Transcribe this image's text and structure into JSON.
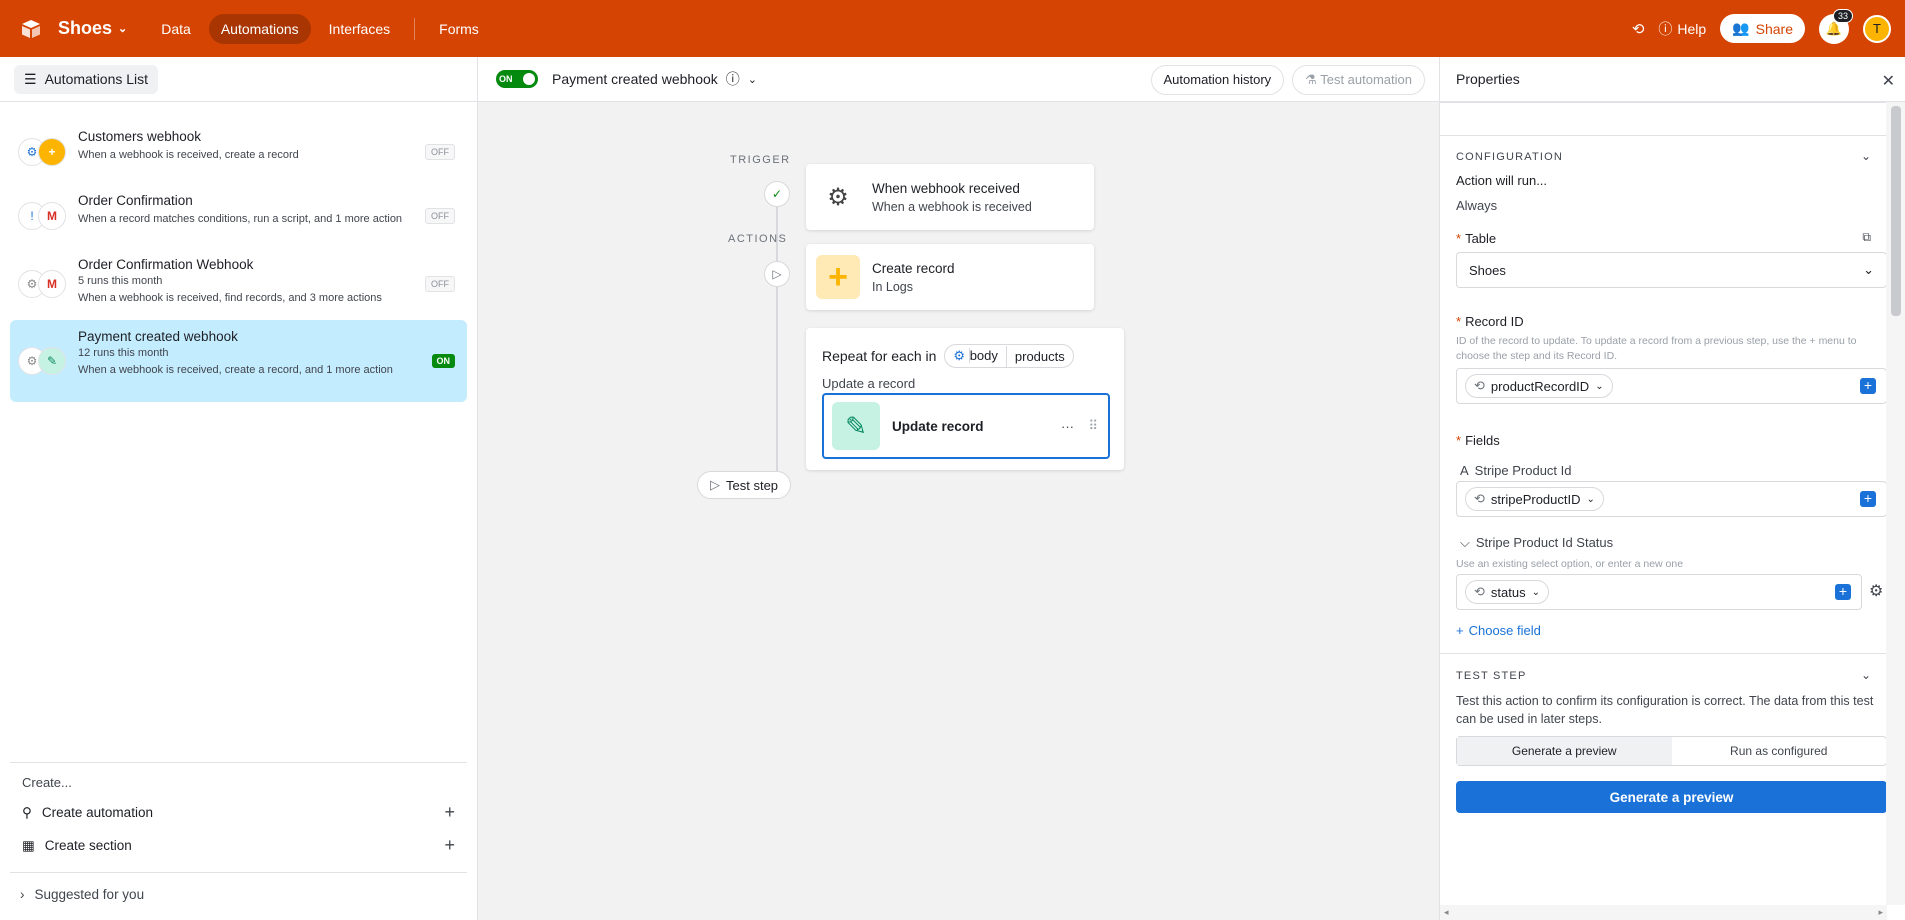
{
  "app": {
    "base_name": "Shoes",
    "nav": [
      "Data",
      "Automations",
      "Interfaces",
      "Forms"
    ],
    "help_label": "Help",
    "share_label": "Share",
    "notification_count": "33",
    "avatar_initial": "T",
    "brand_color": "#d54402"
  },
  "left": {
    "list_button": "Automations List",
    "automations": [
      {
        "title": "Customers webhook",
        "runs": "",
        "desc": "When a webhook is received, create a record",
        "status": "OFF"
      },
      {
        "title": "Order Confirmation",
        "runs": "",
        "desc": "When a record matches conditions, run a script, and 1 more action",
        "status": "OFF"
      },
      {
        "title": "Order Confirmation Webhook",
        "runs": "5 runs this month",
        "desc": "When a webhook is received, find records, and 3 more actions",
        "status": "OFF"
      },
      {
        "title": "Payment created webhook",
        "runs": "12 runs this month",
        "desc": "When a webhook is received, create a record, and 1 more action",
        "status": "ON"
      }
    ],
    "create_label": "Create...",
    "create_automation": "Create automation",
    "create_section": "Create section",
    "suggested": "Suggested for you"
  },
  "center": {
    "toggle_label": "ON",
    "automation_name": "Payment created webhook",
    "history_button": "Automation history",
    "test_button": "Test automation",
    "trigger_label": "TRIGGER",
    "actions_label": "ACTIONS",
    "trigger": {
      "title": "When webhook received",
      "sub": "When a webhook is received"
    },
    "create_record": {
      "title": "Create record",
      "sub": "In Logs"
    },
    "repeat": {
      "title": "Repeat for each in",
      "token1": "body",
      "token2": "products",
      "sub": "Update a record"
    },
    "update_record": {
      "title": "Update record",
      "more": "···"
    },
    "test_step": "Test step"
  },
  "properties": {
    "title": "Properties",
    "configuration": "CONFIGURATION",
    "action_will_run": "Action will run...",
    "always": "Always",
    "table_label": "Table",
    "table_value": "Shoes",
    "record_id_label": "Record ID",
    "record_id_hint": "ID of the record to update. To update a record from a previous step, use the + menu to choose the step and its Record ID.",
    "record_id_token": "productRecordID",
    "fields_label": "Fields",
    "field1_name": "Stripe Product Id",
    "field1_token": "stripeProductID",
    "field2_name": "Stripe Product Id Status",
    "field2_hint": "Use an existing select option, or enter a new one",
    "field2_token": "status",
    "choose_field": "Choose field",
    "test_step_head": "TEST STEP",
    "test_desc": "Test this action to confirm its configuration is correct. The data from this test can be used in later steps.",
    "seg_preview": "Generate a preview",
    "seg_configured": "Run as configured",
    "primary_button": "Generate a preview"
  }
}
